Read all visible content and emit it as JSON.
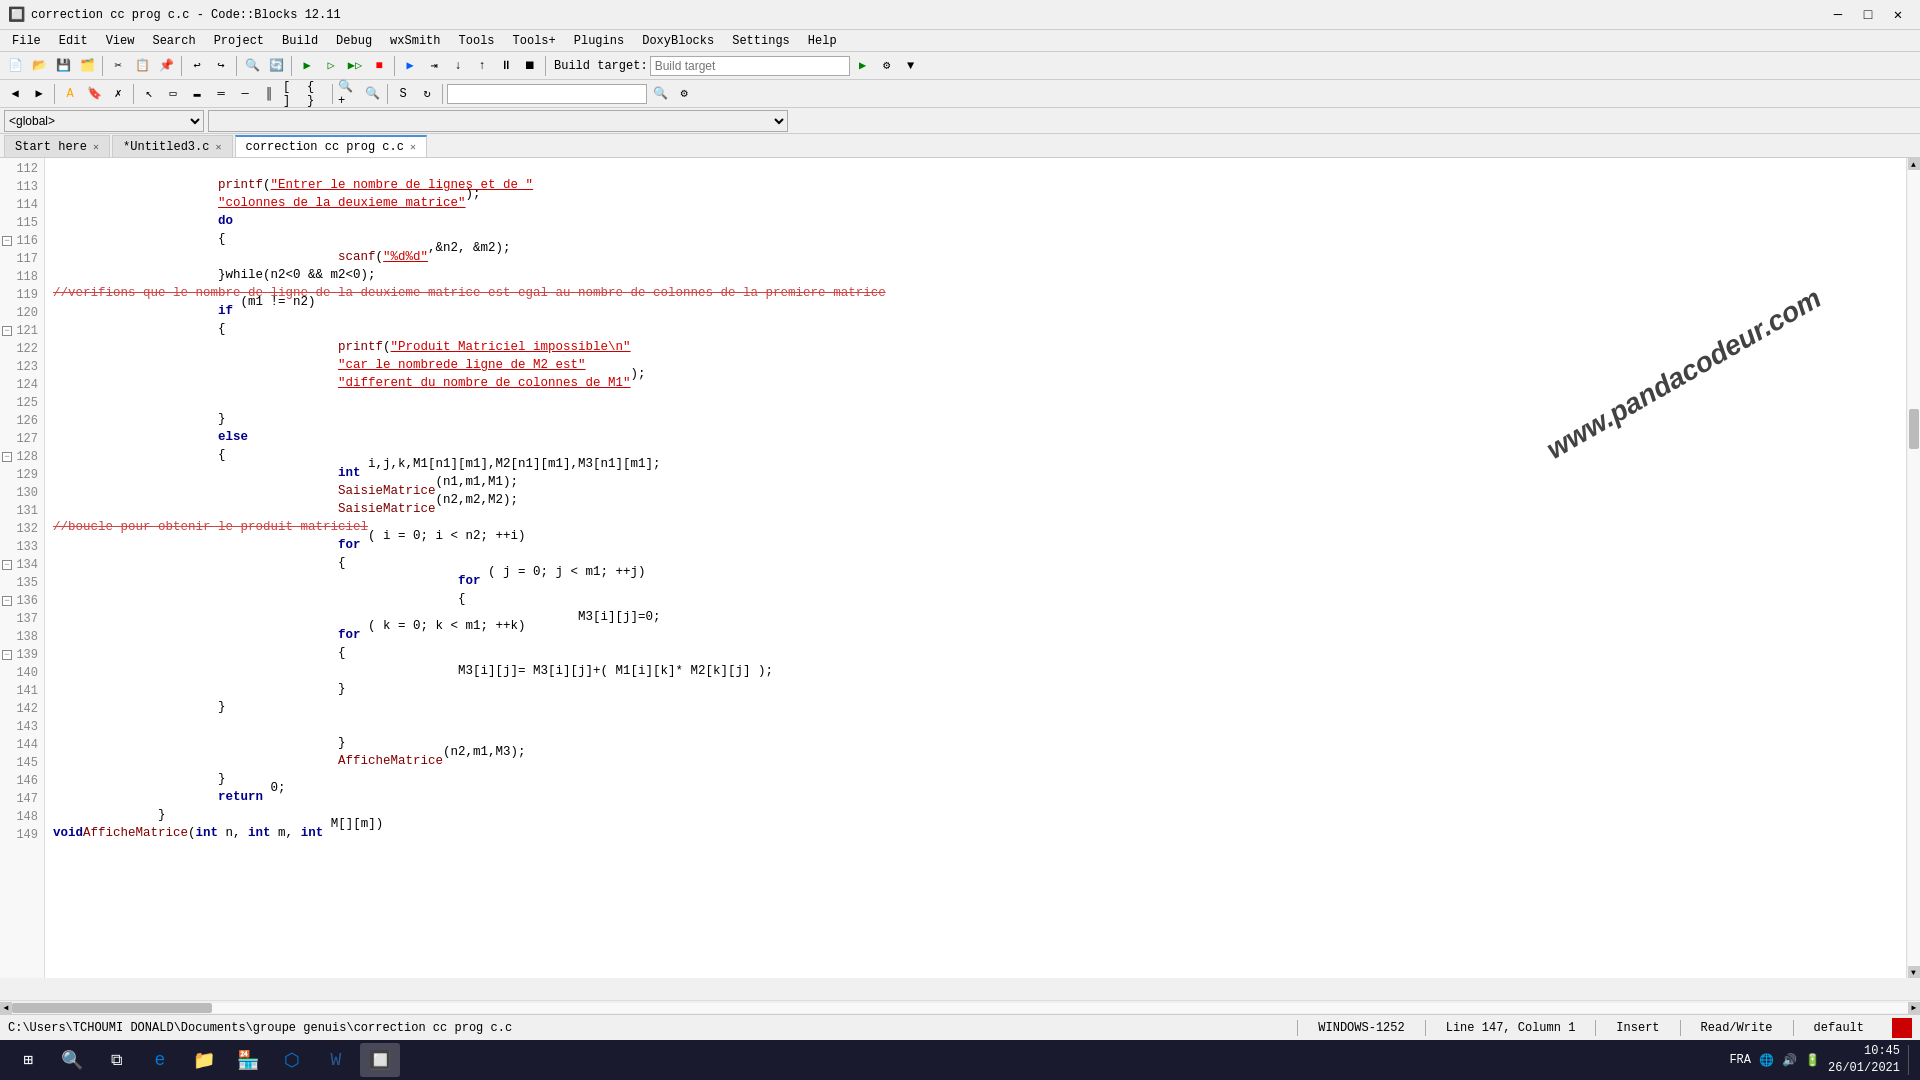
{
  "titlebar": {
    "title": "correction cc prog c.c - Code::Blocks 12.11",
    "minimize": "─",
    "maximize": "□",
    "close": "✕"
  },
  "menu": {
    "items": [
      "File",
      "Edit",
      "View",
      "Search",
      "Project",
      "Build",
      "Debug",
      "wxSmith",
      "Tools",
      "Tools+",
      "Plugins",
      "DoxyBlocks",
      "Settings",
      "Help"
    ]
  },
  "tabs": {
    "items": [
      {
        "label": "Start here",
        "closable": true
      },
      {
        "label": "*Untitled3.c",
        "closable": true
      },
      {
        "label": "correction cc prog c.c",
        "closable": true,
        "active": true
      }
    ]
  },
  "global_dropdown": "<global>",
  "build_target": "Build targets",
  "code": {
    "lines": [
      {
        "num": 112,
        "fold": false,
        "content": ""
      },
      {
        "num": 113,
        "fold": false,
        "content": "                printf(\"Entrer le nombre de lignes et de \""
      },
      {
        "num": 114,
        "fold": false,
        "content": "                \"colonnes de la deuxieme matrice\");"
      },
      {
        "num": 115,
        "fold": false,
        "content": "                do"
      },
      {
        "num": 116,
        "fold": true,
        "content": "                {"
      },
      {
        "num": 117,
        "fold": false,
        "content": "                                scanf(\"%d%d\",&n2, &m2);"
      },
      {
        "num": 118,
        "fold": false,
        "content": "                }while(n2<0 && m2<0);"
      },
      {
        "num": 119,
        "fold": false,
        "content": "//verifions que le nombre de ligne de la deuxieme matrice est egal au nombre de colonnes de la premiere matrice"
      },
      {
        "num": 120,
        "fold": false,
        "content": "                if (m1 != n2)"
      },
      {
        "num": 121,
        "fold": true,
        "content": "                {"
      },
      {
        "num": 122,
        "fold": false,
        "content": "                                printf(\"Produit Matriciel impossible\\n\""
      },
      {
        "num": 123,
        "fold": false,
        "content": "                                \"car le nombrede ligne de M2 est\""
      },
      {
        "num": 124,
        "fold": false,
        "content": "                                \"different du nombre de colonnes de M1\");"
      },
      {
        "num": 125,
        "fold": false,
        "content": ""
      },
      {
        "num": 126,
        "fold": false,
        "content": "                }"
      },
      {
        "num": 127,
        "fold": false,
        "content": "                else"
      },
      {
        "num": 128,
        "fold": true,
        "content": "                {"
      },
      {
        "num": 129,
        "fold": false,
        "content": "                                int i,j,k,M1[n1][m1],M2[n1][m1],M3[n1][m1];"
      },
      {
        "num": 130,
        "fold": false,
        "content": "                                SaisieMatrice(n1,m1,M1);"
      },
      {
        "num": 131,
        "fold": false,
        "content": "                                SaisieMatrice(n2,m2,M2);"
      },
      {
        "num": 132,
        "fold": false,
        "content": "//boucle pour obtenir le produit matriciel"
      },
      {
        "num": 133,
        "fold": false,
        "content": "                                for ( i = 0; i < n2; ++i)"
      },
      {
        "num": 134,
        "fold": true,
        "content": "                                {"
      },
      {
        "num": 135,
        "fold": false,
        "content": "                                                for ( j = 0; j < m1; ++j)"
      },
      {
        "num": 136,
        "fold": true,
        "content": "                                                {"
      },
      {
        "num": 137,
        "fold": false,
        "content": "                                                                M3[i][j]=0;"
      },
      {
        "num": 138,
        "fold": false,
        "content": "                                for ( k = 0; k < m1; ++k)"
      },
      {
        "num": 139,
        "fold": true,
        "content": "                                {"
      },
      {
        "num": 140,
        "fold": false,
        "content": "                                                M3[i][j]= M3[i][j]+( M1[i][k]* M2[k][j] );"
      },
      {
        "num": 141,
        "fold": false,
        "content": "                                }"
      },
      {
        "num": 142,
        "fold": false,
        "content": "                }"
      },
      {
        "num": 143,
        "fold": false,
        "content": ""
      },
      {
        "num": 144,
        "fold": false,
        "content": "                                }"
      },
      {
        "num": 145,
        "fold": false,
        "content": "                                AfficheMatrice(n2,m1,M3);"
      },
      {
        "num": 146,
        "fold": false,
        "content": "                }"
      },
      {
        "num": 147,
        "fold": false,
        "content": "                return 0;"
      },
      {
        "num": 148,
        "fold": false,
        "content": "        }"
      },
      {
        "num": 149,
        "fold": false,
        "content": "void AfficheMatrice(int n, int m, int M[][m])"
      }
    ]
  },
  "statusbar": {
    "path": "C:\\Users\\TCHOUMI DONALD\\Documents\\groupe genuis\\correction cc prog c.c",
    "encoding": "WINDOWS-1252",
    "position": "Line 147, Column 1",
    "mode": "Insert",
    "access": "Read/Write",
    "language": "default"
  },
  "taskbar": {
    "time": "10:45",
    "date": "26/01/2021",
    "lang": "FRA"
  },
  "watermark": "www.pandacodeur.com"
}
